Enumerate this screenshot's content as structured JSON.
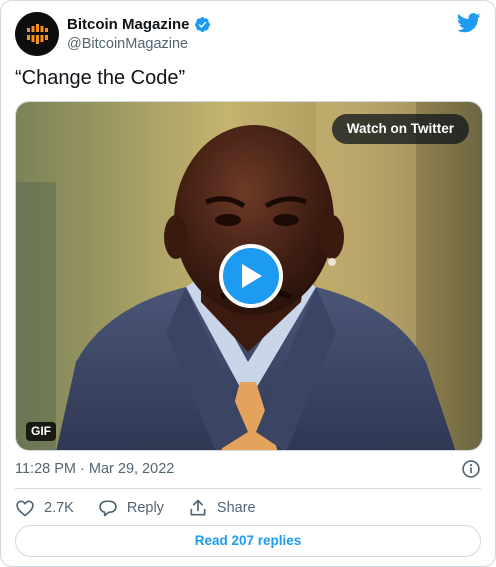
{
  "author": {
    "display_name": "Bitcoin Magazine",
    "handle": "@BitcoinMagazine",
    "verified": true
  },
  "tweet": {
    "text": "“Change the Code”",
    "timestamp": "11:28 PM · Mar 29, 2022"
  },
  "media": {
    "watch_label": "Watch on Twitter",
    "badge": "GIF"
  },
  "actions": {
    "likes": "2.7K",
    "reply_label": "Reply",
    "share_label": "Share"
  },
  "replies_button": "Read 207 replies",
  "colors": {
    "accent": "#1d9bf0",
    "text_secondary": "#536471",
    "border": "#cfd9de"
  },
  "icons": [
    "avatar-logo",
    "verified-badge-icon",
    "twitter-bird-icon",
    "play-icon",
    "info-icon",
    "heart-icon",
    "reply-bubble-icon",
    "share-icon"
  ]
}
